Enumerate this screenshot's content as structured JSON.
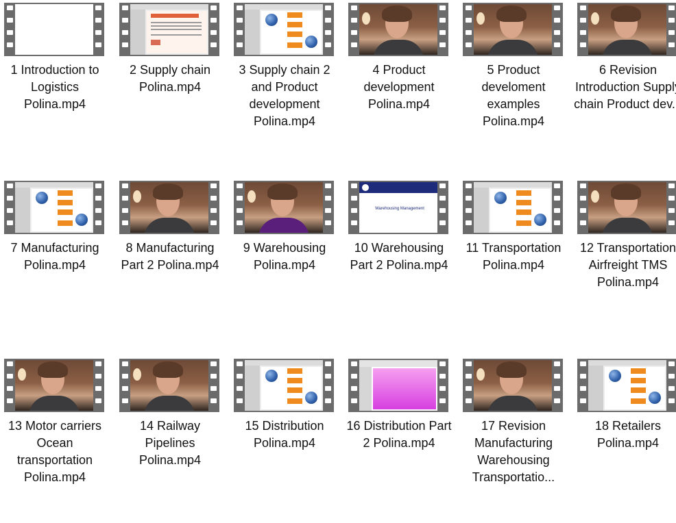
{
  "files": [
    {
      "label": "1 Introduction to Logistics Polina.mp4",
      "thumb": "blank"
    },
    {
      "label": "2 Supply chain Polina.mp4",
      "thumb": "text-slide"
    },
    {
      "label": "3 Supply chain 2 and Product development Polina.mp4",
      "thumb": "diagram-slide"
    },
    {
      "label": "4 Product development Polina.mp4",
      "thumb": "video"
    },
    {
      "label": "5 Product develoment examples Polina.mp4",
      "thumb": "video"
    },
    {
      "label": "6 Revision Introduction Supply chain Product dev...",
      "thumb": "video"
    },
    {
      "label": "7 Manufacturing Polina.mp4",
      "thumb": "diagram-slide"
    },
    {
      "label": "8 Manufacturing Part 2 Polina.mp4",
      "thumb": "video"
    },
    {
      "label": "9 Warehousing Polina.mp4",
      "thumb": "video-purple"
    },
    {
      "label": "10 Warehousing Part 2 Polina.mp4",
      "thumb": "title-slide",
      "thumb_caption": "Warehousing Management"
    },
    {
      "label": "11 Transportation Polina.mp4",
      "thumb": "diagram-slide"
    },
    {
      "label": "12 Transportation Airfreight TMS Polina.mp4",
      "thumb": "video"
    },
    {
      "label": "13 Motor carriers Ocean transportation Polina.mp4",
      "thumb": "video"
    },
    {
      "label": "14 Railway Pipelines Polina.mp4",
      "thumb": "video"
    },
    {
      "label": "15 Distribution Polina.mp4",
      "thumb": "diagram-slide"
    },
    {
      "label": "16 Distribution Part 2 Polina.mp4",
      "thumb": "purple-slide"
    },
    {
      "label": "17 Revision Manufacturing Warehousing Transportatio...",
      "thumb": "video"
    },
    {
      "label": "18 Retailers Polina.mp4",
      "thumb": "diagram-slide"
    }
  ],
  "icon": "video-file-icon",
  "colors": {
    "film": "#6b6b6b",
    "text": "#111111",
    "background": "#ffffff"
  }
}
